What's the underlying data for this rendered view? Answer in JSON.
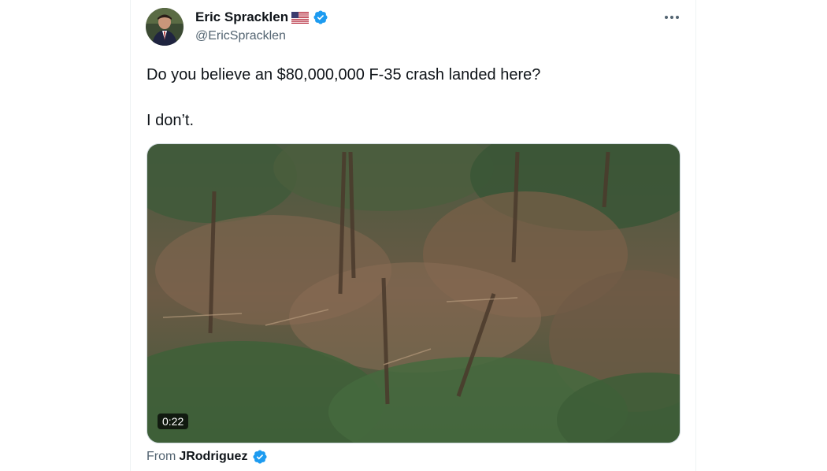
{
  "tweet": {
    "author": {
      "name": "Eric Spracklen",
      "handle": "@EricSpracklen",
      "flag_icon": "us-flag-icon",
      "verified_icon": "verified-badge-icon"
    },
    "text_line1": "Do you believe an $80,000,000 F-35 crash landed here?",
    "text_line2": "I don’t.",
    "media": {
      "type": "video",
      "duration": "0:22"
    },
    "attribution": {
      "label": "From",
      "source": "JRodriguez",
      "verified_icon": "verified-badge-icon"
    },
    "menu_icon": "more-options-icon"
  },
  "colors": {
    "text": "#0f1419",
    "secondary": "#536471",
    "verified": "#1d9bf0",
    "border": "#eff3f4"
  }
}
